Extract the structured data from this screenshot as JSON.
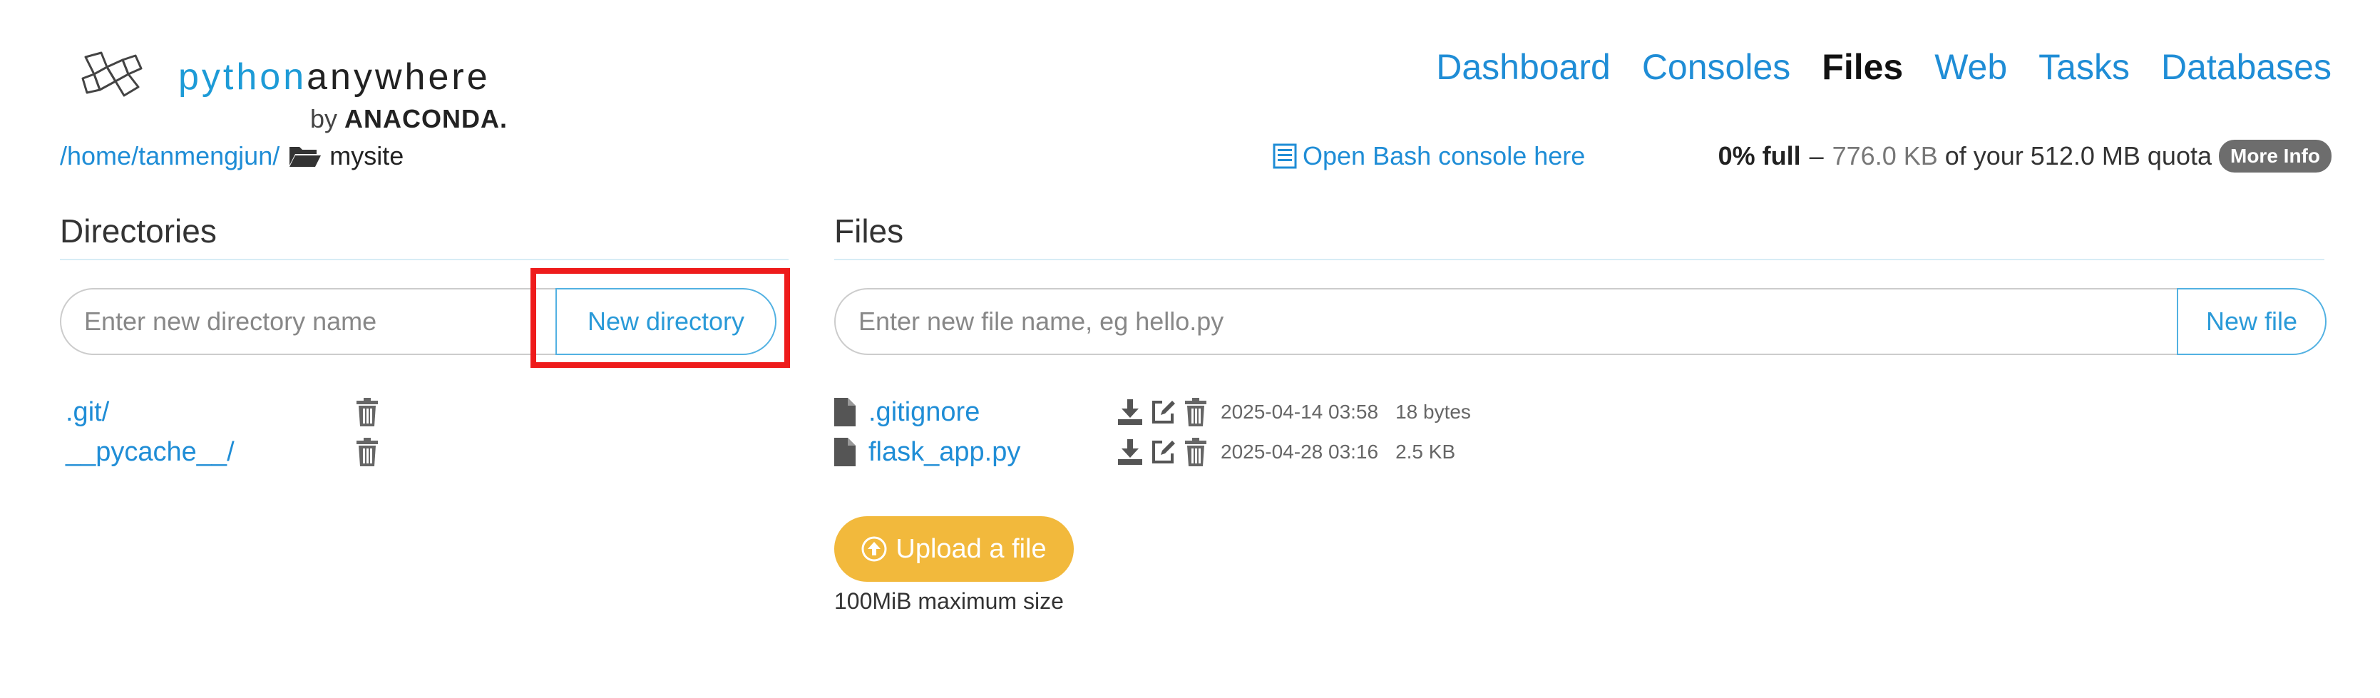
{
  "brand": {
    "word_python": "python",
    "word_anywhere": "anywhere",
    "by": "by",
    "company": "ANACONDA.",
    "color_python": "#1d9bd7"
  },
  "nav": {
    "items": [
      {
        "label": "Dashboard",
        "active": false
      },
      {
        "label": "Consoles",
        "active": false
      },
      {
        "label": "Files",
        "active": true
      },
      {
        "label": "Web",
        "active": false
      },
      {
        "label": "Tasks",
        "active": false
      },
      {
        "label": "Databases",
        "active": false
      }
    ]
  },
  "breadcrumb": {
    "root": "/home",
    "sep1": "/",
    "user": "tanmengjun",
    "sep2": "/",
    "current": "mysite"
  },
  "bash_link": "Open Bash console here",
  "quota": {
    "percent": "0% full",
    "dash": "–",
    "used": "776.0 KB",
    "of_text": "of your 512.0 MB quota",
    "more_info": "More Info"
  },
  "directories": {
    "heading": "Directories",
    "input_placeholder": "Enter new directory name",
    "button": "New directory",
    "items": [
      ".git/",
      "__pycache__/"
    ]
  },
  "files": {
    "heading": "Files",
    "input_placeholder": "Enter new file name, eg hello.py",
    "button": "New file",
    "items": [
      {
        "name": ".gitignore",
        "modified": "2025-04-14 03:58",
        "size": "18 bytes"
      },
      {
        "name": "flask_app.py",
        "modified": "2025-04-28 03:16",
        "size": "2.5 KB"
      }
    ],
    "upload_button": "Upload a file",
    "upload_note": "100MiB maximum size"
  },
  "colors": {
    "link": "#1f8dd6",
    "upload": "#f2b93c",
    "highlight": "#ee1b1b",
    "badge": "#6d6d6d"
  },
  "icons": [
    "logo-mark-icon",
    "folder-open-icon",
    "terminal-icon",
    "trash-icon",
    "file-icon",
    "download-icon",
    "edit-icon",
    "upload-arrow-icon"
  ]
}
